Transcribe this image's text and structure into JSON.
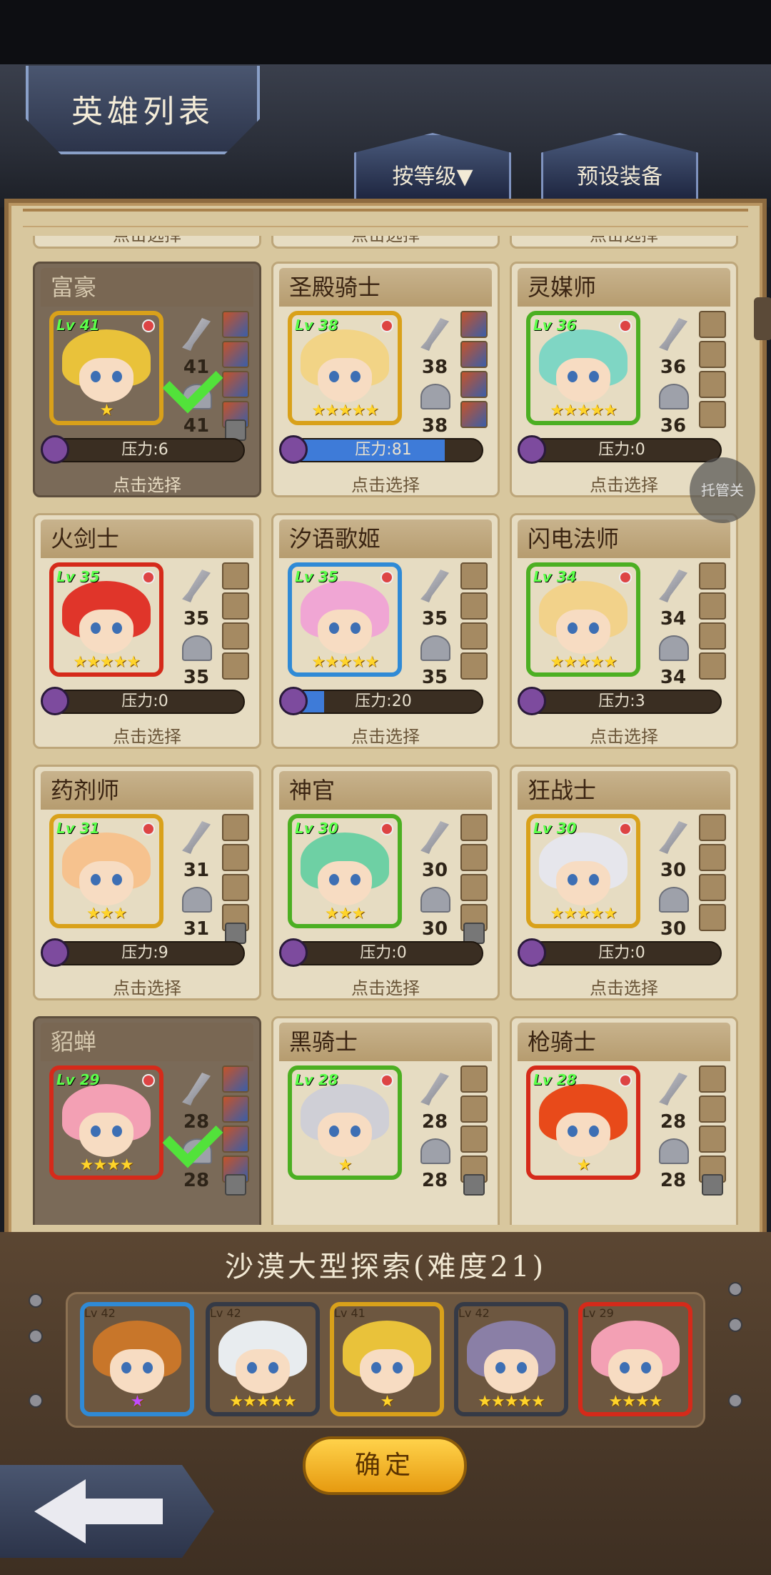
{
  "header": {
    "title": "英雄列表",
    "sort_tab": "按等级▼",
    "preset_tab": "预设装备"
  },
  "autoplay_label": "托管关",
  "select_label": "点击选择",
  "heroes": [
    {
      "name": "富豪",
      "lv": "Lv 41",
      "atk": "41",
      "def": "41",
      "pressure": "压力:6",
      "pressure_pct": 0,
      "stars": "★",
      "frame": "gold",
      "in_team": true,
      "hair": "#e9c23a"
    },
    {
      "name": "圣殿骑士",
      "lv": "Lv 38",
      "atk": "38",
      "def": "38",
      "pressure": "压力:81",
      "pressure_pct": 81,
      "stars": "★★★★★",
      "frame": "gold",
      "in_team": false,
      "hair": "#f2d486"
    },
    {
      "name": "灵媒师",
      "lv": "Lv 36",
      "atk": "36",
      "def": "36",
      "pressure": "压力:0",
      "pressure_pct": 0,
      "stars": "★★★★★",
      "frame": "green",
      "in_team": false,
      "hair": "#7fd6c4"
    },
    {
      "name": "火剑士",
      "lv": "Lv 35",
      "atk": "35",
      "def": "35",
      "pressure": "压力:0",
      "pressure_pct": 0,
      "stars": "★★★★★",
      "frame": "red",
      "in_team": false,
      "hair": "#e0352a"
    },
    {
      "name": "汐语歌姬",
      "lv": "Lv 35",
      "atk": "35",
      "def": "35",
      "pressure": "压力:20",
      "pressure_pct": 20,
      "stars": "★★★★★",
      "frame": "blue",
      "in_team": false,
      "hair": "#f0a6d4"
    },
    {
      "name": "闪电法师",
      "lv": "Lv 34",
      "atk": "34",
      "def": "34",
      "pressure": "压力:3",
      "pressure_pct": 0,
      "stars": "★★★★★",
      "frame": "green",
      "in_team": false,
      "hair": "#f2d28a"
    },
    {
      "name": "药剂师",
      "lv": "Lv 31",
      "atk": "31",
      "def": "31",
      "pressure": "压力:9",
      "pressure_pct": 0,
      "stars": "★★★",
      "frame": "gold",
      "in_team": false,
      "hair": "#f6c28e"
    },
    {
      "name": "神官",
      "lv": "Lv 30",
      "atk": "30",
      "def": "30",
      "pressure": "压力:0",
      "pressure_pct": 0,
      "stars": "★★★",
      "frame": "green",
      "in_team": false,
      "hair": "#6ed0a4"
    },
    {
      "name": "狂战士",
      "lv": "Lv 30",
      "atk": "30",
      "def": "30",
      "pressure": "压力:0",
      "pressure_pct": 0,
      "stars": "★★★★★",
      "frame": "gold",
      "in_team": false,
      "hair": "#e6e6ec"
    },
    {
      "name": "貂蝉",
      "lv": "Lv 29",
      "atk": "28",
      "def": "28",
      "pressure": "",
      "pressure_pct": 0,
      "stars": "★★★★",
      "frame": "red",
      "in_team": true,
      "hair": "#f3a0b4"
    },
    {
      "name": "黑骑士",
      "lv": "Lv 28",
      "atk": "28",
      "def": "28",
      "pressure": "",
      "pressure_pct": 0,
      "stars": "★",
      "frame": "green",
      "in_team": false,
      "hair": "#cfcfd6"
    },
    {
      "name": "枪骑士",
      "lv": "Lv 28",
      "atk": "28",
      "def": "28",
      "pressure": "",
      "pressure_pct": 0,
      "stars": "★",
      "frame": "red",
      "in_team": false,
      "hair": "#e84a1a"
    }
  ],
  "mission": {
    "title": "沙漠大型探索(难度21)"
  },
  "team": [
    {
      "lv": "Lv 42",
      "stars": "★",
      "star_color": "purple",
      "frame": "blue",
      "hair": "#c8762a"
    },
    {
      "lv": "Lv 42",
      "stars": "★★★★★",
      "star_color": "gold",
      "frame": "dark",
      "hair": "#e8ecef"
    },
    {
      "lv": "Lv 41",
      "stars": "★",
      "star_color": "gold",
      "frame": "gold",
      "hair": "#e9c23a"
    },
    {
      "lv": "Lv 42",
      "stars": "★★★★★",
      "star_color": "gold",
      "frame": "dark",
      "hair": "#8a7fa6"
    },
    {
      "lv": "Lv 29",
      "stars": "★★★★",
      "star_color": "gold",
      "frame": "red",
      "hair": "#f3a0b4"
    }
  ],
  "buttons": {
    "confirm": "确定"
  }
}
